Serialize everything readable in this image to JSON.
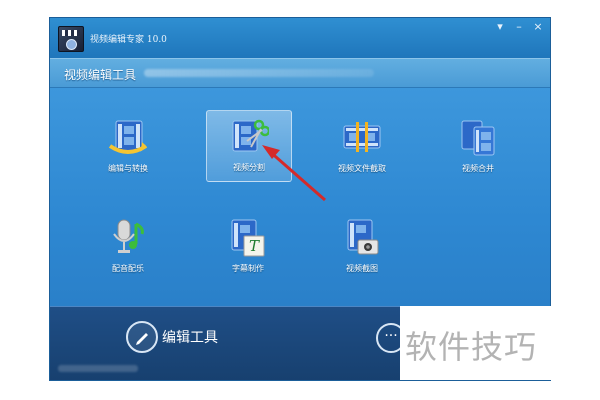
{
  "window": {
    "title": "视频编辑专家 10.0",
    "controls": {
      "menu": "▾",
      "minimize": "–",
      "close": "×"
    }
  },
  "header": {
    "section_title": "视频编辑工具"
  },
  "tools": [
    {
      "label": "编辑与转换",
      "icon": "film-convert-icon"
    },
    {
      "label": "视频分割",
      "icon": "film-scissors-icon",
      "selected": true
    },
    {
      "label": "视频文件截取",
      "icon": "film-strip-cut-icon"
    },
    {
      "label": "视频合并",
      "icon": "film-merge-icon"
    },
    {
      "label": "配音配乐",
      "icon": "microphone-music-icon"
    },
    {
      "label": "字幕制作",
      "icon": "subtitle-t-icon"
    },
    {
      "label": "视频截图",
      "icon": "camera-screenshot-icon"
    }
  ],
  "bottom_nav": {
    "edit_tools": "编辑工具",
    "more": "···"
  },
  "watermark": "软件技巧",
  "colors": {
    "window_blue": "#2a83c6",
    "bottom_navy": "#1f4e86",
    "arrow_red": "#d42a2a"
  }
}
